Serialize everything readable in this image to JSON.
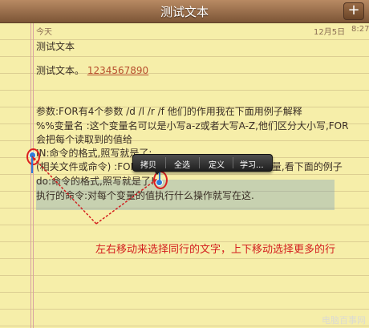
{
  "title": "测试文本",
  "add_button": "+",
  "meta": {
    "today": "今天",
    "date": "12月5日",
    "time": "8:27"
  },
  "lines": [
    "测试文本",
    "测试文本。",
    "1234567890",
    "参数:FOR有4个参数 /d   /l   /r   /f   他们的作用我在下面用例子解释",
    "%%变量名 :这个变量名可以是小写a-z或者大写A-Z,他们区分大小写,FOR",
    "会把每个读取到的值给",
    "IN:命令的格式,照写就是了;",
    "(相关文件或命令) :FOR要把什么东西读取然后赋值给变量,看下面的例子",
    "do:命令的格式,照写就是了!",
    "执行的命令:对每个变量的值执行什么操作就写在这."
  ],
  "menu": [
    "拷贝",
    "全选",
    "定义",
    "学习..."
  ],
  "annotation": "左右移动来选择同行的文字，上下移动选择更多的行",
  "watermark": "电脑百事网"
}
